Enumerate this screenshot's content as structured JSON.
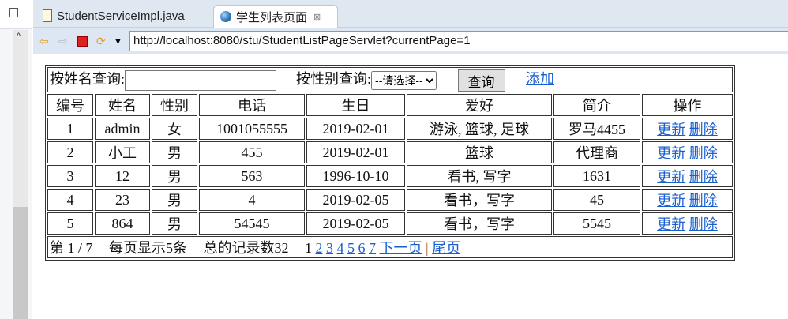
{
  "tabs": [
    {
      "label": "StudentServiceImpl.java",
      "icon": "java-file-icon"
    },
    {
      "label": "学生列表页面",
      "icon": "globe-icon",
      "close": "⊠"
    }
  ],
  "address": "http://localhost:8080/stu/StudentListPageServlet?currentPage=1",
  "search": {
    "name_label": "按姓名查询:",
    "name_value": "",
    "sex_label": "按性别查询:",
    "sex_selected": "--请选择--",
    "query_button": "查询",
    "add_link": "添加"
  },
  "headers": [
    "编号",
    "姓名",
    "性别",
    "电话",
    "生日",
    "爱好",
    "简介",
    "操作"
  ],
  "rows": [
    [
      "1",
      "admin",
      "女",
      "1001055555",
      "2019-02-01",
      "游泳, 篮球, 足球",
      "罗马4455"
    ],
    [
      "2",
      "小工",
      "男",
      "455",
      "2019-02-01",
      "篮球",
      "代理商"
    ],
    [
      "3",
      "12",
      "男",
      "563",
      "1996-10-10",
      "看书, 写字",
      "1631"
    ],
    [
      "4",
      "23",
      "男",
      "4",
      "2019-02-05",
      "看书，写字",
      "45"
    ],
    [
      "5",
      "864",
      "男",
      "54545",
      "2019-02-05",
      "看书，写字",
      "5545"
    ]
  ],
  "actions": {
    "update": "更新",
    "delete": "删除"
  },
  "footer": {
    "page_info": "第 1 / 7",
    "page_size": "每页显示5条",
    "total": "总的记录数32",
    "current": "1",
    "pages": [
      "2",
      "3",
      "4",
      "5",
      "6",
      "7"
    ],
    "next": "下一页",
    "sep": "|",
    "last": "尾页"
  }
}
